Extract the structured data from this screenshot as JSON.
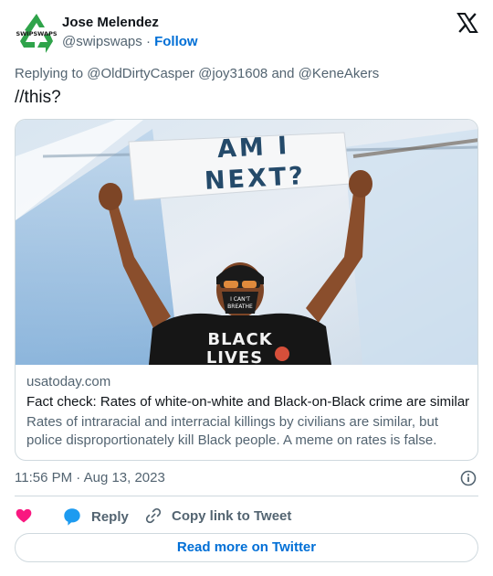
{
  "author": {
    "name": "Jose Melendez",
    "handle": "@swipswaps",
    "separator": "·",
    "follow_label": "Follow",
    "avatar_text": "SWIPSWAPS"
  },
  "reply_to": {
    "prefix": "Replying to",
    "mentions": [
      "@OldDirtyCasper",
      "@joy31608",
      "@KeneAkers"
    ],
    "joiner": "and"
  },
  "tweet": {
    "text": "//this?",
    "timestamp": "11:56 PM · Aug 13, 2023"
  },
  "card": {
    "sign_line_1": "AM I",
    "sign_line_2": "NEXT?",
    "mask_text": "I CAN'T BREATHE",
    "shirt_text": "BLACK LIVES",
    "domain": "usatoday.com",
    "title": "Fact check: Rates of white-on-white and Black-on-Black crime are similar",
    "description": "Rates of intraracial and interracial killings by civilians are similar, but police disproportionately kill Black people. A meme on rates is false."
  },
  "actions": {
    "reply_label": "Reply",
    "copy_label": "Copy link to Tweet",
    "read_more_label": "Read more on Twitter"
  },
  "colors": {
    "link": "#006fd6",
    "muted": "#536471",
    "like": "#f91880",
    "reply_bubble": "#1d9bf0",
    "border": "#cfd9de"
  },
  "icons": [
    "recycle-avatar-icon",
    "x-logo-icon",
    "info-icon",
    "heart-icon",
    "reply-bubble-icon",
    "link-icon"
  ]
}
